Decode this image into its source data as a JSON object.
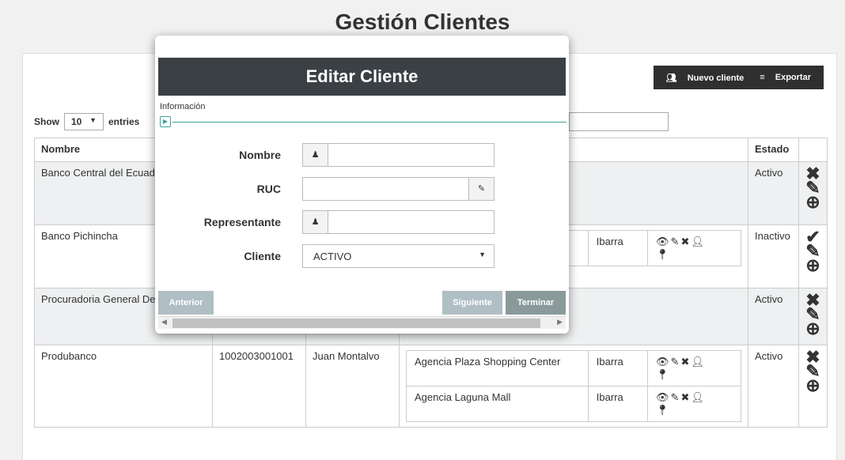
{
  "page": {
    "title": "Gestión Clientes"
  },
  "toolbar": {
    "new_client": "Nuevo cliente",
    "export": "Exportar"
  },
  "table_controls": {
    "show": "Show",
    "entries_value": "10",
    "entries": "entries"
  },
  "table": {
    "headers": {
      "nombre": "Nombre",
      "estado": "Estado"
    },
    "rows": [
      {
        "nombre": "Banco Central del Ecuador",
        "estado": "Activo"
      },
      {
        "nombre": "Banco Pichincha",
        "estado": "Inactivo",
        "agency_city": "Ibarra"
      },
      {
        "nombre": "Procuradoria General Del Estado",
        "estado": "Activo"
      },
      {
        "nombre": "Produbanco",
        "ruc": "1002003001001",
        "representante": "Juan Montalvo",
        "estado": "Activo",
        "agencies": [
          {
            "name": "Agencia Plaza Shopping Center",
            "city": "Ibarra"
          },
          {
            "name": "Agencia Laguna Mall",
            "city": "Ibarra"
          }
        ]
      }
    ]
  },
  "modal": {
    "title": "Editar Cliente",
    "step_label": "Información",
    "fields": {
      "nombre": {
        "label": "Nombre",
        "value": ""
      },
      "ruc": {
        "label": "RUC",
        "value": ""
      },
      "representante": {
        "label": "Representante",
        "value": ""
      },
      "cliente": {
        "label": "Cliente",
        "value": "ACTIVO"
      }
    },
    "buttons": {
      "previous": "Anterior",
      "next": "Siguiente",
      "finish": "Terminar"
    }
  },
  "icons": [
    "users-icon",
    "menu-icon",
    "close-icon",
    "pencil-icon",
    "plus-circle-icon",
    "check-icon",
    "eye-icon",
    "user-icon",
    "map-marker-icon",
    "caret-down-icon"
  ],
  "colors": {
    "modal_header": "#3b4045",
    "toolbar": "#2f2f2f",
    "step_accent": "#3ba3a0",
    "btn_disabled": "#b0bec5",
    "btn_finish": "#8a9a9a"
  }
}
